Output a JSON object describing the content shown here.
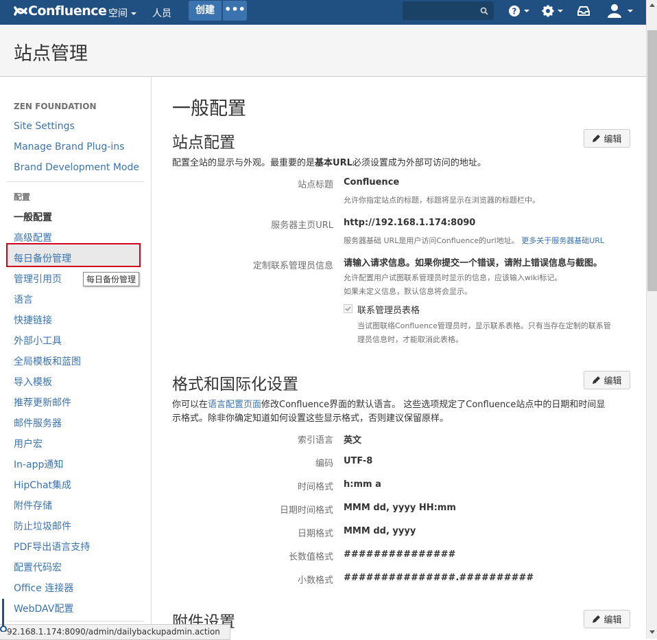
{
  "nav": {
    "logo": "Confluence",
    "spaces": "空间",
    "people": "人员",
    "create": "创建",
    "more": "•••"
  },
  "header": {
    "title": "站点管理"
  },
  "sidebar": {
    "section1": "ZEN FOUNDATION",
    "items1": [
      "Site Settings",
      "Manage Brand Plug-ins",
      "Brand Development Mode"
    ],
    "section2": "配置",
    "items2": [
      "一般配置",
      "高级配置",
      "每日备份管理",
      "管理引用页",
      "语言",
      "快捷链接",
      "外部小工具",
      "全局模板和蓝图",
      "导入模板",
      "推荐更新邮件",
      "邮件服务器",
      "用户宏",
      "In-app通知",
      "HipChat集成",
      "附件存储",
      "防止垃圾邮件",
      "PDF导出语言支持",
      "配置代码宏",
      "Office 连接器",
      "WebDAV配置"
    ],
    "tooltip": "每日备份管理"
  },
  "main": {
    "title": "一般配置",
    "edit": "编辑",
    "site": {
      "heading": "站点配置",
      "desc_pre": "配置全站的显示与外观。最重要的是",
      "desc_bold": "基本URL",
      "desc_post": "必须设置成为外部可访问的地址。",
      "title_label": "站点标题",
      "title_value": "Confluence",
      "title_help": "允许你指定站点的标题，标题将显示在浏览器的标题栏中。",
      "url_label": "服务器主页URL",
      "url_value": "http://192.168.1.174:8090",
      "url_help": "服务器基础 URL是用户访问Confluence的url地址。",
      "url_help_link": "更多关于服务器基础URL",
      "contact_label": "定制联系管理员信息",
      "contact_value": "请输入请求信息。如果你提交一个错误，请附上错误信息与截图。",
      "contact_help1": "允许配置用户试图联系管理员时显示的信息，应该输入wiki标记。",
      "contact_help2": "如果未定义信息，默认信息将会显示。",
      "form_label": "联系管理员表格",
      "form_help1": "当试图联络Confluence管理员时，显示联系表格。只有当存在定制的联系管",
      "form_help2": "理员信息时，才能取消此表格。"
    },
    "format": {
      "heading": "格式和国际化设置",
      "desc1_pre": "你可以在",
      "desc1_link": "语言配置页面",
      "desc1_post": "修改Confluence界面的默认语言。 这些选项规定了Confluence站点中的日期和时间显",
      "desc2": "示格式。除非你确定知道如何设置这些显示格式，否则建议保留原样。",
      "rows": [
        {
          "label": "索引语言",
          "value": "英文"
        },
        {
          "label": "编码",
          "value": "UTF-8"
        },
        {
          "label": "时间格式",
          "value": "h:mm a"
        },
        {
          "label": "日期时间格式",
          "value": "MMM dd, yyyy HH:mm"
        },
        {
          "label": "日期格式",
          "value": "MMM dd, yyyy"
        },
        {
          "label": "长数值格式",
          "value": "###############"
        },
        {
          "label": "小数格式",
          "value": "###############.##########"
        }
      ]
    },
    "attach": {
      "heading": "附件设置"
    }
  },
  "status": {
    "url": "92.168.1.174:8090/admin/dailybackupadmin.action"
  },
  "colors": {
    "nav": "#205081",
    "link": "#3b73af",
    "highlight": "#d0021b"
  }
}
